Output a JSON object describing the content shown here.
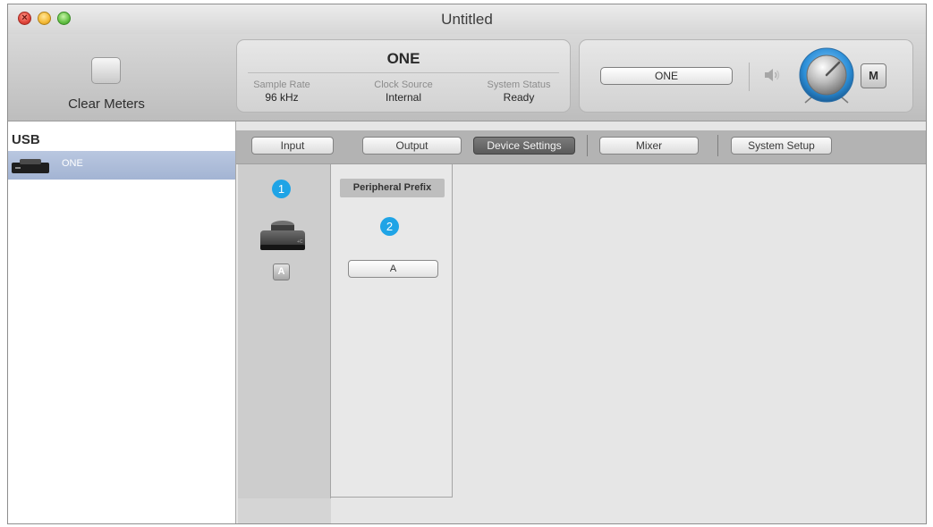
{
  "window": {
    "title": "Untitled",
    "close_glyph": "×"
  },
  "toolbar": {
    "clear_meters_label": "Clear Meters",
    "device_name": "ONE",
    "stats": [
      {
        "label": "Sample Rate",
        "value": "96 kHz"
      },
      {
        "label": "Clock Source",
        "value": "Internal"
      },
      {
        "label": "System Status",
        "value": "Ready"
      }
    ],
    "device_select_value": "ONE",
    "mute_label": "M"
  },
  "sidebar": {
    "header": "USB",
    "items": [
      {
        "label": "ONE",
        "icon": "usb-device-icon"
      }
    ]
  },
  "tabs": [
    {
      "label": "Input",
      "active": false
    },
    {
      "label": "Output",
      "active": false
    },
    {
      "label": "Device Settings",
      "active": true
    },
    {
      "label": "Mixer",
      "active": false
    },
    {
      "label": "System Setup",
      "active": false
    }
  ],
  "device_settings": {
    "callout_1": "1",
    "callout_2": "2",
    "device_prefix_badge": "A",
    "peripheral_prefix_header": "Peripheral Prefix",
    "peripheral_prefix_value": "A"
  },
  "icons": {
    "speaker": "speaker-icon",
    "knob": "volume-knob-icon",
    "device": "device-icon"
  },
  "colors": {
    "callout": "#1fa4e6",
    "selection": "#a9b9d6",
    "active_tab": "#666666"
  }
}
